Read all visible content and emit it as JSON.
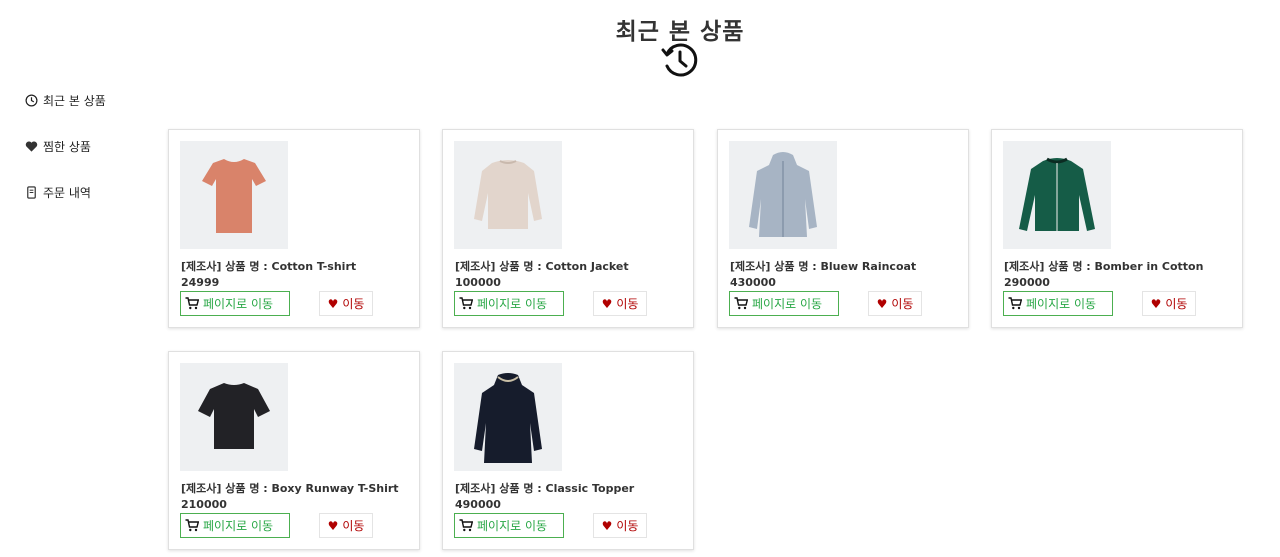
{
  "page": {
    "title": "최근 본 상품"
  },
  "sidebar": {
    "items": [
      {
        "label": "최근 본 상품",
        "icon": "clock-icon"
      },
      {
        "label": "찜한 상품",
        "icon": "heart-icon"
      },
      {
        "label": "주문 내역",
        "icon": "receipt-icon"
      }
    ]
  },
  "products": [
    {
      "name": "[제조사] 상품 명 : Cotton T-shirt",
      "price": "24999",
      "go_label": "페이지로 이동",
      "like_label": "이동",
      "color": "#d9836a"
    },
    {
      "name": "[제조사] 상품 명 : Cotton Jacket",
      "price": "100000",
      "go_label": "페이지로 이동",
      "like_label": "이동",
      "color": "#e2d5cc"
    },
    {
      "name": "[제조사] 상품 명 : Bluew Raincoat",
      "price": "430000",
      "go_label": "페이지로 이동",
      "like_label": "이동",
      "color": "#a7b4c4"
    },
    {
      "name": "[제조사] 상품 명 : Bomber in Cotton",
      "price": "290000",
      "go_label": "페이지로 이동",
      "like_label": "이동",
      "color": "#155c47"
    },
    {
      "name": "[제조사] 상품 명 : Boxy Runway T-Shirt",
      "price": "210000",
      "go_label": "페이지로 이동",
      "like_label": "이동",
      "color": "#222226"
    },
    {
      "name": "[제조사] 상품 명 : Classic Topper",
      "price": "490000",
      "go_label": "페이지로 이동",
      "like_label": "이동",
      "color": "#161c2c"
    }
  ],
  "colors": {
    "go_button": "#28a745",
    "like_button": "#b00000"
  }
}
